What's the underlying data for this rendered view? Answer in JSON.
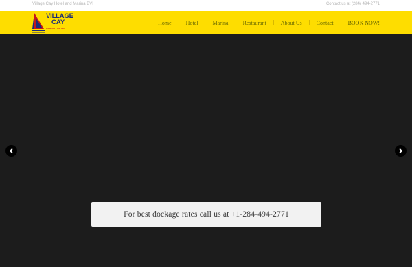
{
  "topbar": {
    "left_text": "Village Cay Hotel and Marina BVI",
    "right_text": "Contact us at (284) 494-2771"
  },
  "logo": {
    "line1": "VILLAGE",
    "line2": "CAY",
    "line3": "MARINA • HOTEL",
    "colors": {
      "blue": "#1a2b7a",
      "red": "#c4161c",
      "yellow": "#fedd00"
    }
  },
  "nav": {
    "items": [
      {
        "label": "Home"
      },
      {
        "label": "Hotel"
      },
      {
        "label": "Marina"
      },
      {
        "label": "Restaurant"
      },
      {
        "label": "About Us"
      },
      {
        "label": "Contact"
      },
      {
        "label": "BOOK NOW!"
      }
    ]
  },
  "hero": {
    "caption": "For best dockage rates call us at +1-284-494-2771",
    "prev_icon": "chevron-left-icon",
    "next_icon": "chevron-right-icon"
  },
  "colors": {
    "navbar": "#fedd00",
    "hero_bg": "#1c1c1c",
    "caption_bg": "#f2f2f2"
  }
}
